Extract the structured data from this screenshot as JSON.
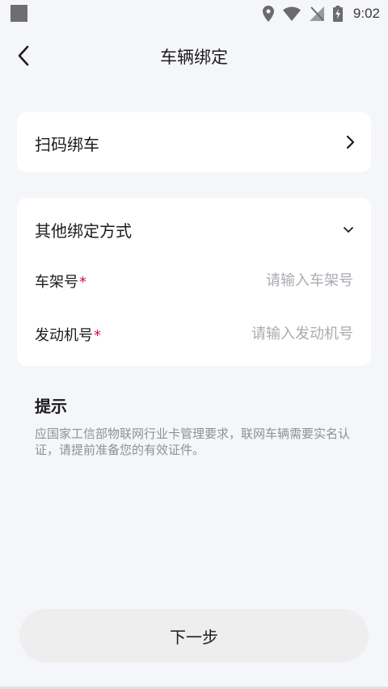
{
  "status_bar": {
    "time": "9:02"
  },
  "header": {
    "title": "车辆绑定"
  },
  "scan_card": {
    "label": "扫码绑车"
  },
  "other_card": {
    "title": "其他绑定方式",
    "fields": [
      {
        "label": "车架号",
        "required_mark": "*",
        "placeholder": "请输入车架号",
        "value": ""
      },
      {
        "label": "发动机号",
        "required_mark": "*",
        "placeholder": "请输入发动机号",
        "value": ""
      }
    ]
  },
  "tips": {
    "title": "提示",
    "text": "应国家工信部物联网行业卡管理要求，联网车辆需要实名认证，请提前准备您的有效证件。"
  },
  "footer": {
    "next_label": "下一步"
  },
  "icons": {
    "back": "chevron-left-icon",
    "scan_arrow": "chevron-right-icon",
    "expand": "chevron-down-icon"
  },
  "colors": {
    "background": "#f5f6fa",
    "card": "#ffffff",
    "required": "#d0103a",
    "placeholder": "#a9abb1",
    "button": "#eeeeee"
  }
}
